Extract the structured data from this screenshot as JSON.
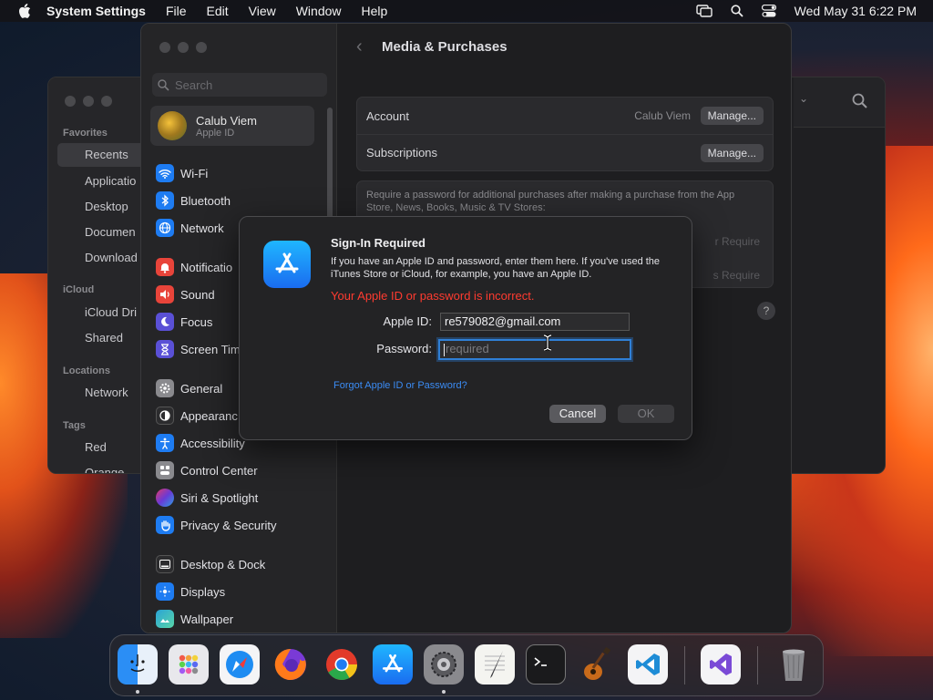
{
  "menubar": {
    "app_name": "System Settings",
    "menus": [
      "File",
      "Edit",
      "View",
      "Window",
      "Help"
    ],
    "clock": "Wed May 31  6:22 PM"
  },
  "finder": {
    "sections": {
      "favorites": "Favorites",
      "icloud": "iCloud",
      "locations": "Locations",
      "tags": "Tags"
    },
    "items": {
      "recents": "Recents",
      "applications": "Applicatio",
      "desktop": "Desktop",
      "documents": "Documen",
      "downloads": "Download",
      "icloud_drive": "iCloud Dri",
      "shared": "Shared",
      "network": "Network",
      "red": "Red",
      "orange": "Orange"
    }
  },
  "settings": {
    "search_placeholder": "Search",
    "profile": {
      "name": "Calub Viem",
      "subtitle": "Apple ID"
    },
    "nav": [
      {
        "label": "Wi-Fi",
        "icon": "wifi-icon",
        "color": "#1e7cf2"
      },
      {
        "label": "Bluetooth",
        "icon": "bluetooth-icon",
        "color": "#1e7cf2"
      },
      {
        "label": "Network",
        "icon": "globe-icon",
        "color": "#1e7cf2"
      },
      {
        "label": "Notificatio",
        "icon": "bell-icon",
        "color": "#e8443a"
      },
      {
        "label": "Sound",
        "icon": "speaker-icon",
        "color": "#e8443a"
      },
      {
        "label": "Focus",
        "icon": "moon-icon",
        "color": "#5a50d6"
      },
      {
        "label": "Screen Tim",
        "icon": "hourglass-icon",
        "color": "#5a50d6"
      },
      {
        "label": "General",
        "icon": "gear-icon",
        "color": "#8a8a8e"
      },
      {
        "label": "Appearanc",
        "icon": "appearance-icon",
        "color": "#2c2c2e"
      },
      {
        "label": "Accessibility",
        "icon": "accessibility-icon",
        "color": "#1e7cf2"
      },
      {
        "label": "Control Center",
        "icon": "control-center-icon",
        "color": "#8a8a8e"
      },
      {
        "label": "Siri & Spotlight",
        "icon": "siri-icon",
        "color": "#b03aa8"
      },
      {
        "label": "Privacy & Security",
        "icon": "hand-icon",
        "color": "#1e7cf2"
      },
      {
        "label": "Desktop & Dock",
        "icon": "dock-icon",
        "color": "#2c2c2e"
      },
      {
        "label": "Displays",
        "icon": "display-icon",
        "color": "#1e7cf2"
      },
      {
        "label": "Wallpaper",
        "icon": "wallpaper-icon",
        "color": "#2aa3d6"
      }
    ],
    "main": {
      "title": "Media & Purchases",
      "account_label": "Account",
      "account_value": "Calub Viem",
      "manage_label": "Manage...",
      "subscriptions_label": "Subscriptions",
      "manage2_label": "Manage...",
      "require_desc": "Require a password for additional purchases after making a purchase from the App Store, News, Books, Music & TV Stores:",
      "require_value_1": "r Require",
      "require_value_2": "s Require",
      "help": "?"
    }
  },
  "dialog": {
    "title": "Sign-In Required",
    "message": "If you have an Apple ID and password, enter them here. If you've used the iTunes Store or iCloud, for example, you have an Apple ID.",
    "error": "Your Apple ID or password is incorrect.",
    "apple_id_label": "Apple ID:",
    "apple_id_value": "re579082@gmail.com",
    "password_label": "Password:",
    "password_placeholder": "required",
    "forgot_link": "Forgot Apple ID or Password?",
    "cancel_label": "Cancel",
    "ok_label": "OK",
    "error_color": "#ff3b30",
    "accent_color": "#2f7fd6"
  },
  "dock": {
    "apps": [
      "finder-icon",
      "launchpad-icon",
      "safari-icon",
      "firefox-icon",
      "chrome-icon",
      "app-store-icon",
      "system-settings-icon",
      "textedit-icon",
      "terminal-icon",
      "garageband-icon",
      "vscode-icon",
      "visual-studio-icon",
      "trash-icon"
    ]
  }
}
